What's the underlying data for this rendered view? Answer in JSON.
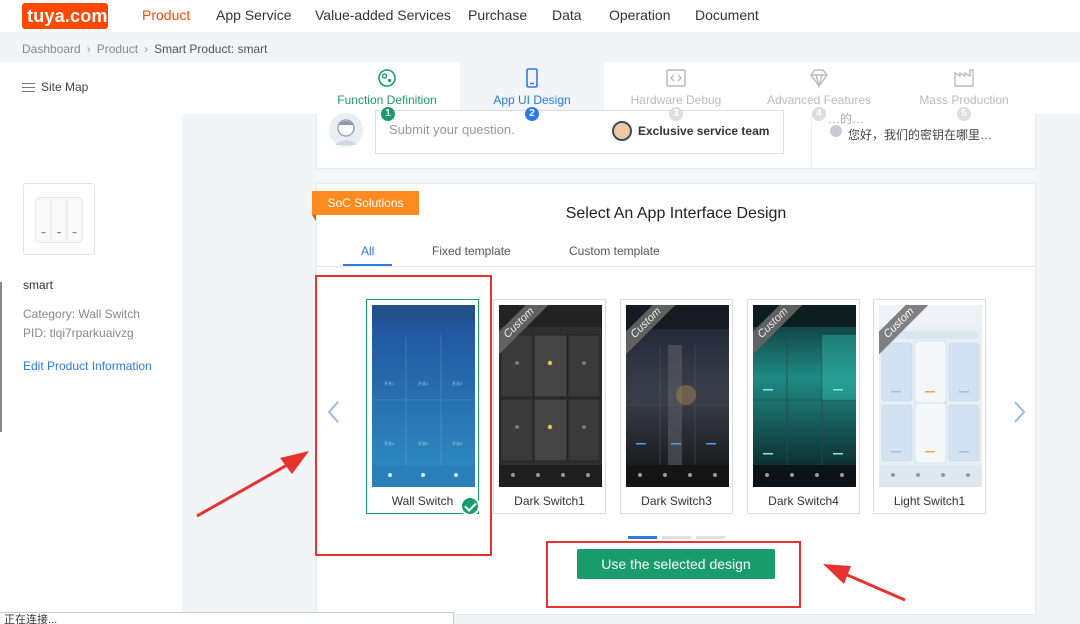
{
  "brand": {
    "logo_text": "tuya.com",
    "accent": "#ff4800"
  },
  "top_nav": {
    "items": [
      "Product",
      "App Service",
      "Value-added Services",
      "Purchase",
      "Data",
      "Operation",
      "Document"
    ]
  },
  "breadcrumb": {
    "items": [
      "Dashboard",
      "Product",
      "Smart Product: smart"
    ]
  },
  "site_map_label": "Site Map",
  "steps": [
    {
      "label": "Function Definition",
      "num": "1",
      "state": "done"
    },
    {
      "label": "App UI Design",
      "num": "2",
      "state": "current"
    },
    {
      "label": "Hardware Debug",
      "num": "3",
      "state": "disabled"
    },
    {
      "label": "Advanced Features",
      "num": "4",
      "state": "disabled"
    },
    {
      "label": "Mass Production",
      "num": "5",
      "state": "disabled"
    }
  ],
  "product": {
    "name": "smart",
    "category": "Category: Wall Switch",
    "pid": "PID: tlqi7rparkuaivzg",
    "edit_link": "Edit Product Information"
  },
  "question": {
    "placeholder": "Submit your question.",
    "service_team": "Exclusive service team",
    "faq_top": "…的…",
    "faq_item": "您好，我们的密钥在哪里…"
  },
  "design": {
    "badge": "SoC Solutions",
    "title": "Select An App Interface Design",
    "tabs": [
      "All",
      "Fixed template",
      "Custom template"
    ],
    "ribbon": "Custom",
    "templates": [
      {
        "name": "Wall Switch",
        "selected": true
      },
      {
        "name": "Dark Switch1",
        "selected": false
      },
      {
        "name": "Dark Switch3",
        "selected": false
      },
      {
        "name": "Dark Switch4",
        "selected": false
      },
      {
        "name": "Light Switch1",
        "selected": false
      }
    ],
    "button": "Use the selected design"
  },
  "status_bar": "正在连接..."
}
